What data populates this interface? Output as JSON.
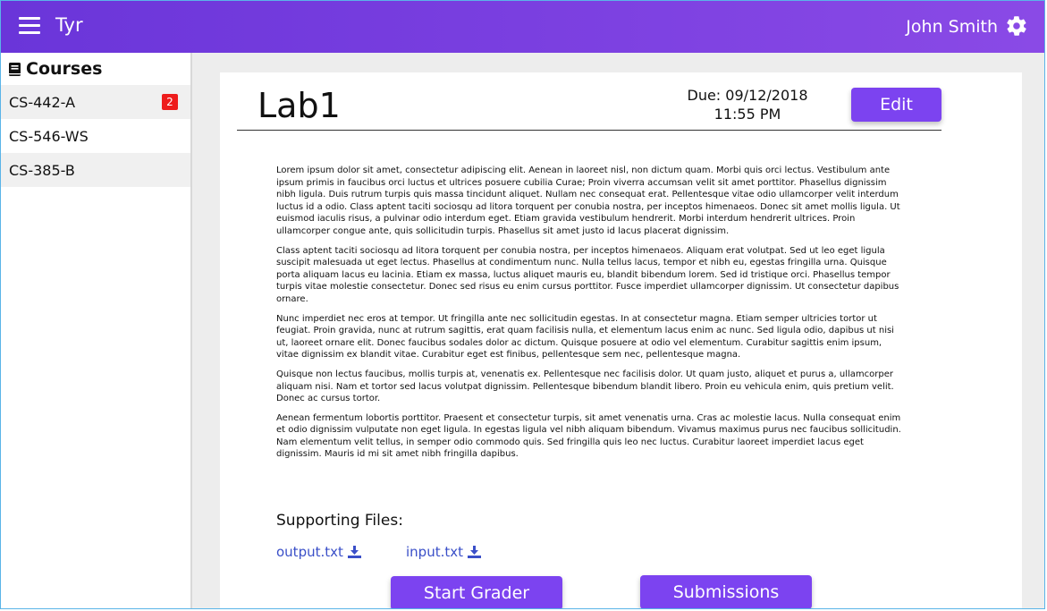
{
  "header": {
    "app_title": "Tyr",
    "user_name": "John Smith"
  },
  "sidebar": {
    "title": "Courses",
    "items": [
      {
        "label": "CS-442-A",
        "badge": "2"
      },
      {
        "label": "CS-546-WS"
      },
      {
        "label": "CS-385-B"
      }
    ]
  },
  "assignment": {
    "title": "Lab1",
    "due_line1": "Due: 09/12/2018",
    "due_line2": "11:55 PM",
    "edit_label": "Edit",
    "paragraphs": [
      "Lorem ipsum dolor sit amet, consectetur adipiscing elit. Aenean in laoreet nisl, non dictum quam. Morbi quis orci lectus. Vestibulum ante ipsum primis in faucibus orci luctus et ultrices posuere cubilia Curae; Proin viverra accumsan velit sit amet porttitor. Phasellus dignissim nibh ligula. Duis rutrum turpis quis massa tincidunt aliquet. Nullam nec consequat erat. Pellentesque vitae odio ullamcorper velit interdum luctus id a odio. Class aptent taciti sociosqu ad litora torquent per conubia nostra, per inceptos himenaeos. Donec sit amet mollis ligula. Ut euismod iaculis risus, a pulvinar odio interdum eget. Etiam gravida vestibulum hendrerit. Morbi interdum hendrerit ultrices. Proin ullamcorper congue ante, quis sollicitudin turpis. Phasellus sit amet justo id lacus placerat dignissim.",
      "Class aptent taciti sociosqu ad litora torquent per conubia nostra, per inceptos himenaeos. Aliquam erat volutpat. Sed ut leo eget ligula suscipit malesuada ut eget lectus. Phasellus at condimentum nunc. Nulla tellus lacus, tempor et nibh eu, egestas fringilla urna. Quisque porta aliquam lacus eu lacinia. Etiam ex massa, luctus aliquet mauris eu, blandit bibendum lorem. Sed id tristique orci. Phasellus tempor turpis vitae molestie consectetur. Donec sed risus eu enim cursus porttitor. Fusce imperdiet ullamcorper dignissim. Ut consectetur dapibus ornare.",
      "Nunc imperdiet nec eros at tempor. Ut fringilla ante nec sollicitudin egestas. In at consectetur magna. Etiam semper ultricies tortor ut feugiat. Proin gravida, nunc at rutrum sagittis, erat quam facilisis nulla, et elementum lacus enim ac nunc. Sed ligula odio, dapibus ut nisi ut, laoreet ornare elit. Donec faucibus sodales dolor ac dictum. Quisque posuere at odio vel elementum. Curabitur sagittis enim ipsum, vitae dignissim ex blandit vitae. Curabitur eget est finibus, pellentesque sem nec, pellentesque magna.",
      "Quisque non lectus faucibus, mollis turpis at, venenatis ex. Pellentesque nec facilisis dolor. Ut quam justo, aliquet et purus a, ullamcorper aliquam nisi. Nam et tortor sed lacus volutpat dignissim. Pellentesque bibendum blandit libero. Proin eu vehicula enim, quis pretium velit. Donec ac cursus tortor.",
      "Aenean fermentum lobortis porttitor. Praesent et consectetur turpis, sit amet venenatis urna. Cras ac molestie lacus. Nulla consequat enim et odio dignissim vulputate non eget ligula. In egestas ligula vel nibh aliquam bibendum. Vivamus maximus purus nec faucibus sollicitudin. Nam elementum velit tellus, in semper odio commodo quis. Sed fringilla quis leo nec luctus. Curabitur laoreet imperdiet lacus eget dignissim. Mauris id mi sit amet nibh fringilla dapibus."
    ],
    "supporting_files_heading": "Supporting Files:",
    "files": [
      {
        "name": "output.txt",
        "icon": "download-icon"
      },
      {
        "name": "input.txt",
        "icon": "download-icon"
      }
    ],
    "start_grader_label": "Start Grader",
    "submissions_label": "Submissions"
  },
  "colors": {
    "topbar": "#7a3fe0",
    "button": "#7c43f0",
    "badge": "#ee1c1c",
    "link": "#3a4fc8"
  }
}
